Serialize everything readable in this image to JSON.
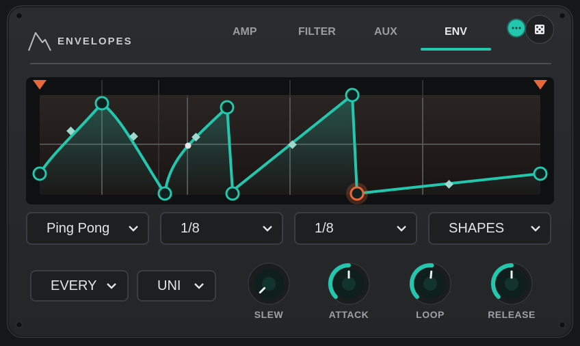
{
  "header": {
    "title": "ENVELOPES",
    "tabs": [
      {
        "label": "AMP",
        "active": false
      },
      {
        "label": "FILTER",
        "active": false
      },
      {
        "label": "AUX",
        "active": false
      },
      {
        "label": "ENV",
        "active": true
      }
    ],
    "more_icon": "ellipsis-icon",
    "dice_icon": "dice-icon"
  },
  "colors": {
    "accent": "#22c7ad",
    "marker": "#e8683a",
    "panel": "#25272a"
  },
  "controls": {
    "mode": {
      "value": "Ping Pong"
    },
    "rate1": {
      "value": "1/8"
    },
    "rate2": {
      "value": "1/8"
    },
    "shapes": {
      "value": "SHAPES"
    },
    "trigger": {
      "value": "EVERY"
    },
    "polarity": {
      "value": "UNI"
    }
  },
  "knobs": [
    {
      "label": "SLEW",
      "value": 0.0
    },
    {
      "label": "ATTACK",
      "value": 0.5
    },
    {
      "label": "LOOP",
      "value": 0.52
    },
    {
      "label": "RELEASE",
      "value": 0.5
    }
  ]
}
